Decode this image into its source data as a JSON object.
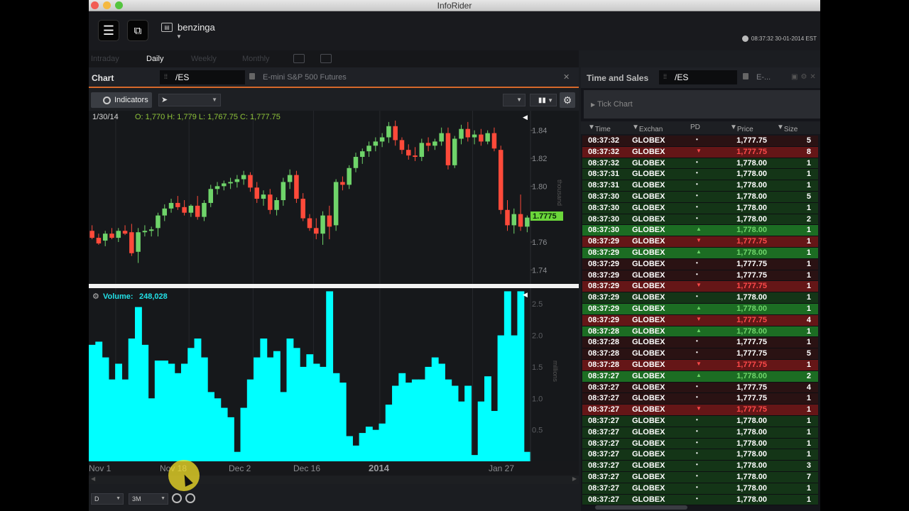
{
  "window": {
    "title": "InfoRider"
  },
  "top": {
    "logo": "benzinga",
    "clock": "08:37:32 30-01-2014 EST"
  },
  "periods": [
    "Intraday",
    "Daily",
    "Weekly",
    "Monthly"
  ],
  "chart_panel": {
    "label": "Chart",
    "symbol": "/ES",
    "description": "E-mini S&P 500 Futures",
    "indicators_label": "Indicators",
    "ohlc_date": "1/30/14",
    "ohlc": "O: 1,770 H: 1,779 L: 1,767.75 C: 1,777.75",
    "price_axis_unit": "thousand",
    "price_ticks": [
      "1.84",
      "1.82",
      "1.80",
      "1.78",
      "1.76",
      "1.74"
    ],
    "current_price": "1.7775",
    "volume_label": "Volume:",
    "volume_value": "248,028",
    "volume_axis_unit": "millions",
    "volume_ticks": [
      "2.5",
      "2.0",
      "1.5",
      "1.0",
      "0.5"
    ],
    "x_labels": [
      "Nov 1",
      "Nov 18",
      "Dec 2",
      "Dec 16",
      "2014",
      "Jan 27"
    ],
    "period_select": "D",
    "range_select": "3M"
  },
  "chart_data": {
    "type": "candlestick",
    "y_range": [
      1.73,
      1.85
    ],
    "volume_range": [
      0,
      2.75
    ],
    "candles": [
      {
        "o": 1.768,
        "h": 1.772,
        "l": 1.762,
        "c": 1.763
      },
      {
        "o": 1.763,
        "h": 1.766,
        "l": 1.758,
        "c": 1.759
      },
      {
        "o": 1.761,
        "h": 1.768,
        "l": 1.757,
        "c": 1.766
      },
      {
        "o": 1.766,
        "h": 1.77,
        "l": 1.762,
        "c": 1.763
      },
      {
        "o": 1.763,
        "h": 1.77,
        "l": 1.76,
        "c": 1.768
      },
      {
        "o": 1.768,
        "h": 1.772,
        "l": 1.765,
        "c": 1.766
      },
      {
        "o": 1.767,
        "h": 1.773,
        "l": 1.75,
        "c": 1.752
      },
      {
        "o": 1.753,
        "h": 1.77,
        "l": 1.745,
        "c": 1.767
      },
      {
        "o": 1.767,
        "h": 1.772,
        "l": 1.764,
        "c": 1.768
      },
      {
        "o": 1.768,
        "h": 1.771,
        "l": 1.764,
        "c": 1.769
      },
      {
        "o": 1.77,
        "h": 1.781,
        "l": 1.764,
        "c": 1.779
      },
      {
        "o": 1.779,
        "h": 1.787,
        "l": 1.775,
        "c": 1.784
      },
      {
        "o": 1.784,
        "h": 1.791,
        "l": 1.781,
        "c": 1.788
      },
      {
        "o": 1.788,
        "h": 1.793,
        "l": 1.783,
        "c": 1.785
      },
      {
        "o": 1.785,
        "h": 1.79,
        "l": 1.779,
        "c": 1.781
      },
      {
        "o": 1.781,
        "h": 1.787,
        "l": 1.778,
        "c": 1.786
      },
      {
        "o": 1.786,
        "h": 1.793,
        "l": 1.776,
        "c": 1.778
      },
      {
        "o": 1.778,
        "h": 1.79,
        "l": 1.775,
        "c": 1.788
      },
      {
        "o": 1.788,
        "h": 1.801,
        "l": 1.785,
        "c": 1.798
      },
      {
        "o": 1.798,
        "h": 1.803,
        "l": 1.794,
        "c": 1.8
      },
      {
        "o": 1.8,
        "h": 1.804,
        "l": 1.797,
        "c": 1.802
      },
      {
        "o": 1.802,
        "h": 1.806,
        "l": 1.798,
        "c": 1.803
      },
      {
        "o": 1.803,
        "h": 1.808,
        "l": 1.799,
        "c": 1.805
      },
      {
        "o": 1.805,
        "h": 1.811,
        "l": 1.801,
        "c": 1.808
      },
      {
        "o": 1.808,
        "h": 1.81,
        "l": 1.796,
        "c": 1.799
      },
      {
        "o": 1.799,
        "h": 1.803,
        "l": 1.788,
        "c": 1.791
      },
      {
        "o": 1.791,
        "h": 1.797,
        "l": 1.786,
        "c": 1.794
      },
      {
        "o": 1.794,
        "h": 1.798,
        "l": 1.78,
        "c": 1.783
      },
      {
        "o": 1.783,
        "h": 1.792,
        "l": 1.779,
        "c": 1.79
      },
      {
        "o": 1.79,
        "h": 1.806,
        "l": 1.786,
        "c": 1.803
      },
      {
        "o": 1.803,
        "h": 1.812,
        "l": 1.798,
        "c": 1.808
      },
      {
        "o": 1.808,
        "h": 1.811,
        "l": 1.788,
        "c": 1.791
      },
      {
        "o": 1.791,
        "h": 1.795,
        "l": 1.775,
        "c": 1.777
      },
      {
        "o": 1.777,
        "h": 1.78,
        "l": 1.768,
        "c": 1.77
      },
      {
        "o": 1.77,
        "h": 1.777,
        "l": 1.762,
        "c": 1.766
      },
      {
        "o": 1.766,
        "h": 1.782,
        "l": 1.758,
        "c": 1.779
      },
      {
        "o": 1.779,
        "h": 1.786,
        "l": 1.762,
        "c": 1.771
      },
      {
        "o": 1.772,
        "h": 1.805,
        "l": 1.768,
        "c": 1.803
      },
      {
        "o": 1.803,
        "h": 1.807,
        "l": 1.797,
        "c": 1.801
      },
      {
        "o": 1.801,
        "h": 1.815,
        "l": 1.798,
        "c": 1.813
      },
      {
        "o": 1.813,
        "h": 1.824,
        "l": 1.81,
        "c": 1.821
      },
      {
        "o": 1.821,
        "h": 1.827,
        "l": 1.816,
        "c": 1.825
      },
      {
        "o": 1.825,
        "h": 1.832,
        "l": 1.821,
        "c": 1.829
      },
      {
        "o": 1.829,
        "h": 1.835,
        "l": 1.825,
        "c": 1.832
      },
      {
        "o": 1.832,
        "h": 1.838,
        "l": 1.828,
        "c": 1.835
      },
      {
        "o": 1.835,
        "h": 1.846,
        "l": 1.831,
        "c": 1.843
      },
      {
        "o": 1.843,
        "h": 1.847,
        "l": 1.829,
        "c": 1.833
      },
      {
        "o": 1.833,
        "h": 1.835,
        "l": 1.823,
        "c": 1.826
      },
      {
        "o": 1.826,
        "h": 1.83,
        "l": 1.819,
        "c": 1.822
      },
      {
        "o": 1.822,
        "h": 1.828,
        "l": 1.818,
        "c": 1.821
      },
      {
        "o": 1.821,
        "h": 1.834,
        "l": 1.818,
        "c": 1.831
      },
      {
        "o": 1.831,
        "h": 1.835,
        "l": 1.825,
        "c": 1.829
      },
      {
        "o": 1.829,
        "h": 1.834,
        "l": 1.826,
        "c": 1.832
      },
      {
        "o": 1.832,
        "h": 1.842,
        "l": 1.829,
        "c": 1.838
      },
      {
        "o": 1.838,
        "h": 1.842,
        "l": 1.812,
        "c": 1.815
      },
      {
        "o": 1.815,
        "h": 1.836,
        "l": 1.813,
        "c": 1.834
      },
      {
        "o": 1.834,
        "h": 1.844,
        "l": 1.83,
        "c": 1.841
      },
      {
        "o": 1.841,
        "h": 1.846,
        "l": 1.832,
        "c": 1.835
      },
      {
        "o": 1.835,
        "h": 1.84,
        "l": 1.83,
        "c": 1.837
      },
      {
        "o": 1.837,
        "h": 1.841,
        "l": 1.829,
        "c": 1.832
      },
      {
        "o": 1.832,
        "h": 1.84,
        "l": 1.83,
        "c": 1.838
      },
      {
        "o": 1.838,
        "h": 1.842,
        "l": 1.825,
        "c": 1.827
      },
      {
        "o": 1.826,
        "h": 1.829,
        "l": 1.78,
        "c": 1.783
      },
      {
        "o": 1.783,
        "h": 1.79,
        "l": 1.768,
        "c": 1.772
      },
      {
        "o": 1.772,
        "h": 1.784,
        "l": 1.766,
        "c": 1.78
      },
      {
        "o": 1.78,
        "h": 1.794,
        "l": 1.768,
        "c": 1.771
      },
      {
        "o": 1.771,
        "h": 1.779,
        "l": 1.767,
        "c": 1.7775
      }
    ],
    "volume": [
      1.85,
      1.9,
      1.65,
      1.3,
      1.55,
      1.3,
      1.95,
      2.45,
      1.85,
      1.0,
      1.6,
      1.6,
      1.55,
      1.4,
      1.55,
      1.8,
      1.95,
      1.65,
      1.1,
      1.0,
      0.85,
      0.7,
      0.15,
      0.85,
      1.3,
      1.65,
      1.95,
      1.65,
      1.75,
      1.1,
      1.95,
      1.8,
      1.5,
      1.7,
      1.55,
      1.5,
      2.7,
      1.4,
      1.25,
      0.4,
      0.25,
      0.45,
      0.55,
      0.5,
      0.6,
      0.9,
      1.2,
      1.4,
      1.25,
      1.3,
      1.3,
      1.5,
      1.65,
      1.55,
      1.3,
      1.2,
      0.95,
      1.2,
      0.1,
      0.95,
      1.35,
      0.8,
      2.0,
      2.7,
      2.0,
      2.7,
      0.15
    ]
  },
  "time_sales": {
    "label": "Time and Sales",
    "symbol": "/ES",
    "description": "E-...",
    "tick_chart_label": "Tick Chart",
    "columns": [
      "Time",
      "Exchan",
      "PD",
      "Price",
      "Size"
    ],
    "rows": [
      {
        "time": "08:37:32",
        "ex": "GLOBEX",
        "pd": "•",
        "price": "1,777.75",
        "size": "5",
        "kind": "neu-r"
      },
      {
        "time": "08:37:32",
        "ex": "GLOBEX",
        "pd": "▼",
        "price": "1,777.75",
        "size": "8",
        "kind": "dn"
      },
      {
        "time": "08:37:32",
        "ex": "GLOBEX",
        "pd": "•",
        "price": "1,778.00",
        "size": "1",
        "kind": "neu"
      },
      {
        "time": "08:37:31",
        "ex": "GLOBEX",
        "pd": "•",
        "price": "1,778.00",
        "size": "1",
        "kind": "neu"
      },
      {
        "time": "08:37:31",
        "ex": "GLOBEX",
        "pd": "•",
        "price": "1,778.00",
        "size": "1",
        "kind": "neu"
      },
      {
        "time": "08:37:30",
        "ex": "GLOBEX",
        "pd": "•",
        "price": "1,778.00",
        "size": "5",
        "kind": "neu"
      },
      {
        "time": "08:37:30",
        "ex": "GLOBEX",
        "pd": "•",
        "price": "1,778.00",
        "size": "1",
        "kind": "neu"
      },
      {
        "time": "08:37:30",
        "ex": "GLOBEX",
        "pd": "•",
        "price": "1,778.00",
        "size": "2",
        "kind": "neu"
      },
      {
        "time": "08:37:30",
        "ex": "GLOBEX",
        "pd": "▲",
        "price": "1,778.00",
        "size": "1",
        "kind": "up"
      },
      {
        "time": "08:37:29",
        "ex": "GLOBEX",
        "pd": "▼",
        "price": "1,777.75",
        "size": "1",
        "kind": "dn"
      },
      {
        "time": "08:37:29",
        "ex": "GLOBEX",
        "pd": "▲",
        "price": "1,778.00",
        "size": "1",
        "kind": "up"
      },
      {
        "time": "08:37:29",
        "ex": "GLOBEX",
        "pd": "•",
        "price": "1,777.75",
        "size": "1",
        "kind": "neu-r"
      },
      {
        "time": "08:37:29",
        "ex": "GLOBEX",
        "pd": "•",
        "price": "1,777.75",
        "size": "1",
        "kind": "neu-r"
      },
      {
        "time": "08:37:29",
        "ex": "GLOBEX",
        "pd": "▼",
        "price": "1,777.75",
        "size": "1",
        "kind": "dn"
      },
      {
        "time": "08:37:29",
        "ex": "GLOBEX",
        "pd": "•",
        "price": "1,778.00",
        "size": "1",
        "kind": "neu"
      },
      {
        "time": "08:37:29",
        "ex": "GLOBEX",
        "pd": "▲",
        "price": "1,778.00",
        "size": "1",
        "kind": "up"
      },
      {
        "time": "08:37:29",
        "ex": "GLOBEX",
        "pd": "▼",
        "price": "1,777.75",
        "size": "4",
        "kind": "dn"
      },
      {
        "time": "08:37:28",
        "ex": "GLOBEX",
        "pd": "▲",
        "price": "1,778.00",
        "size": "1",
        "kind": "up"
      },
      {
        "time": "08:37:28",
        "ex": "GLOBEX",
        "pd": "•",
        "price": "1,777.75",
        "size": "1",
        "kind": "neu-r"
      },
      {
        "time": "08:37:28",
        "ex": "GLOBEX",
        "pd": "•",
        "price": "1,777.75",
        "size": "5",
        "kind": "neu-r"
      },
      {
        "time": "08:37:28",
        "ex": "GLOBEX",
        "pd": "▼",
        "price": "1,777.75",
        "size": "1",
        "kind": "dn"
      },
      {
        "time": "08:37:27",
        "ex": "GLOBEX",
        "pd": "▲",
        "price": "1,778.00",
        "size": "2",
        "kind": "up"
      },
      {
        "time": "08:37:27",
        "ex": "GLOBEX",
        "pd": "•",
        "price": "1,777.75",
        "size": "4",
        "kind": "neu-r"
      },
      {
        "time": "08:37:27",
        "ex": "GLOBEX",
        "pd": "•",
        "price": "1,777.75",
        "size": "1",
        "kind": "neu-r"
      },
      {
        "time": "08:37:27",
        "ex": "GLOBEX",
        "pd": "▼",
        "price": "1,777.75",
        "size": "1",
        "kind": "dn"
      },
      {
        "time": "08:37:27",
        "ex": "GLOBEX",
        "pd": "•",
        "price": "1,778.00",
        "size": "1",
        "kind": "neu"
      },
      {
        "time": "08:37:27",
        "ex": "GLOBEX",
        "pd": "•",
        "price": "1,778.00",
        "size": "1",
        "kind": "neu"
      },
      {
        "time": "08:37:27",
        "ex": "GLOBEX",
        "pd": "•",
        "price": "1,778.00",
        "size": "1",
        "kind": "neu"
      },
      {
        "time": "08:37:27",
        "ex": "GLOBEX",
        "pd": "•",
        "price": "1,778.00",
        "size": "1",
        "kind": "neu"
      },
      {
        "time": "08:37:27",
        "ex": "GLOBEX",
        "pd": "•",
        "price": "1,778.00",
        "size": "3",
        "kind": "neu"
      },
      {
        "time": "08:37:27",
        "ex": "GLOBEX",
        "pd": "•",
        "price": "1,778.00",
        "size": "7",
        "kind": "neu"
      },
      {
        "time": "08:37:27",
        "ex": "GLOBEX",
        "pd": "•",
        "price": "1,778.00",
        "size": "1",
        "kind": "neu"
      },
      {
        "time": "08:37:27",
        "ex": "GLOBEX",
        "pd": "•",
        "price": "1,778.00",
        "size": "1",
        "kind": "neu"
      }
    ]
  },
  "colors": {
    "up": "#6fd46a",
    "down": "#ff4a3a",
    "volume": "#00ffff",
    "accent": "#d6682a"
  }
}
